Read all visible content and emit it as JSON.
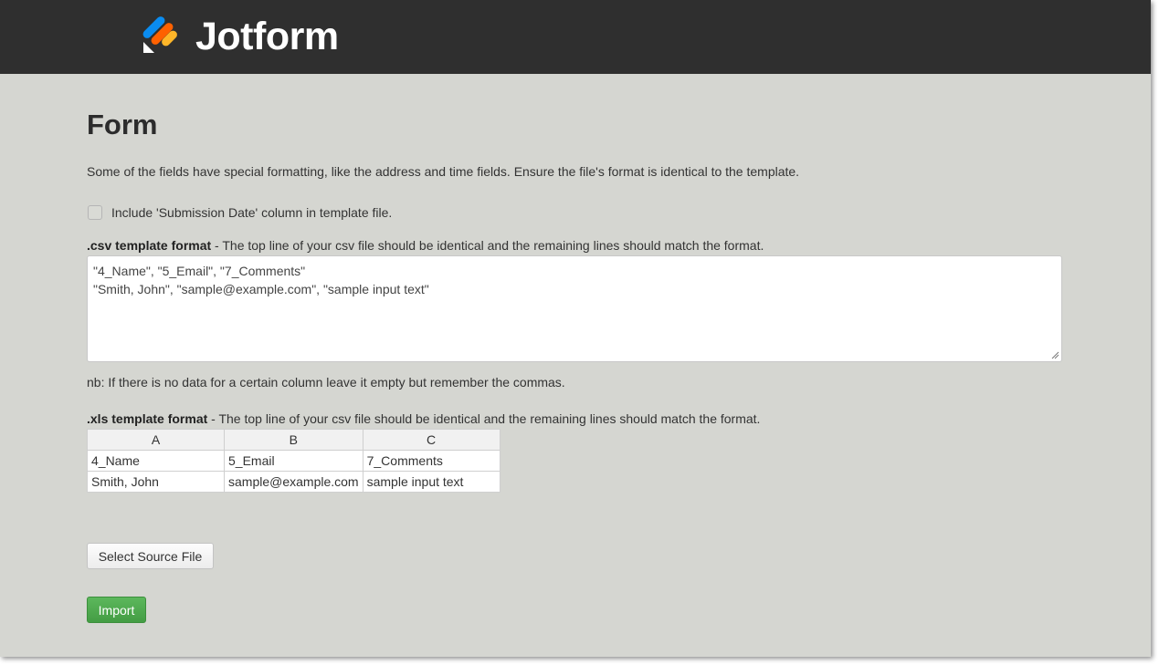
{
  "header": {
    "brand": "Jotform",
    "logo_icon": "jotform-logo-icon",
    "colors": {
      "bar": "#2f2f2f",
      "logo_blue": "#0a8cf0",
      "logo_orange": "#ff6100",
      "logo_yellow": "#ffb629"
    }
  },
  "page": {
    "title": "Form",
    "description": "Some of the fields have special formatting, like the address and time fields. Ensure the file's format is identical to the template.",
    "include_submission_date_label": "Include 'Submission Date' column in template file.",
    "include_submission_date_checked": false
  },
  "csv": {
    "label_bold": ".csv template format",
    "label_rest": " - The top line of your csv file should be identical and the remaining lines should match the format.",
    "lines": [
      "\"4_Name\", \"5_Email\", \"7_Comments\"",
      "\"Smith, John\", \"sample@example.com\", \"sample input text\""
    ]
  },
  "note": "nb: If there is no data for a certain column leave it empty but remember the commas.",
  "xls": {
    "label_bold": ".xls template format",
    "label_rest": " - The top line of your csv file should be identical and the remaining lines should match the format.",
    "columns": [
      "A",
      "B",
      "C"
    ],
    "rows": [
      [
        "4_Name",
        "5_Email",
        "7_Comments"
      ],
      [
        "Smith, John",
        "sample@example.com",
        "sample input text"
      ]
    ]
  },
  "buttons": {
    "select_source": "Select Source File",
    "import": "Import",
    "import_color": "#5cb85c"
  }
}
